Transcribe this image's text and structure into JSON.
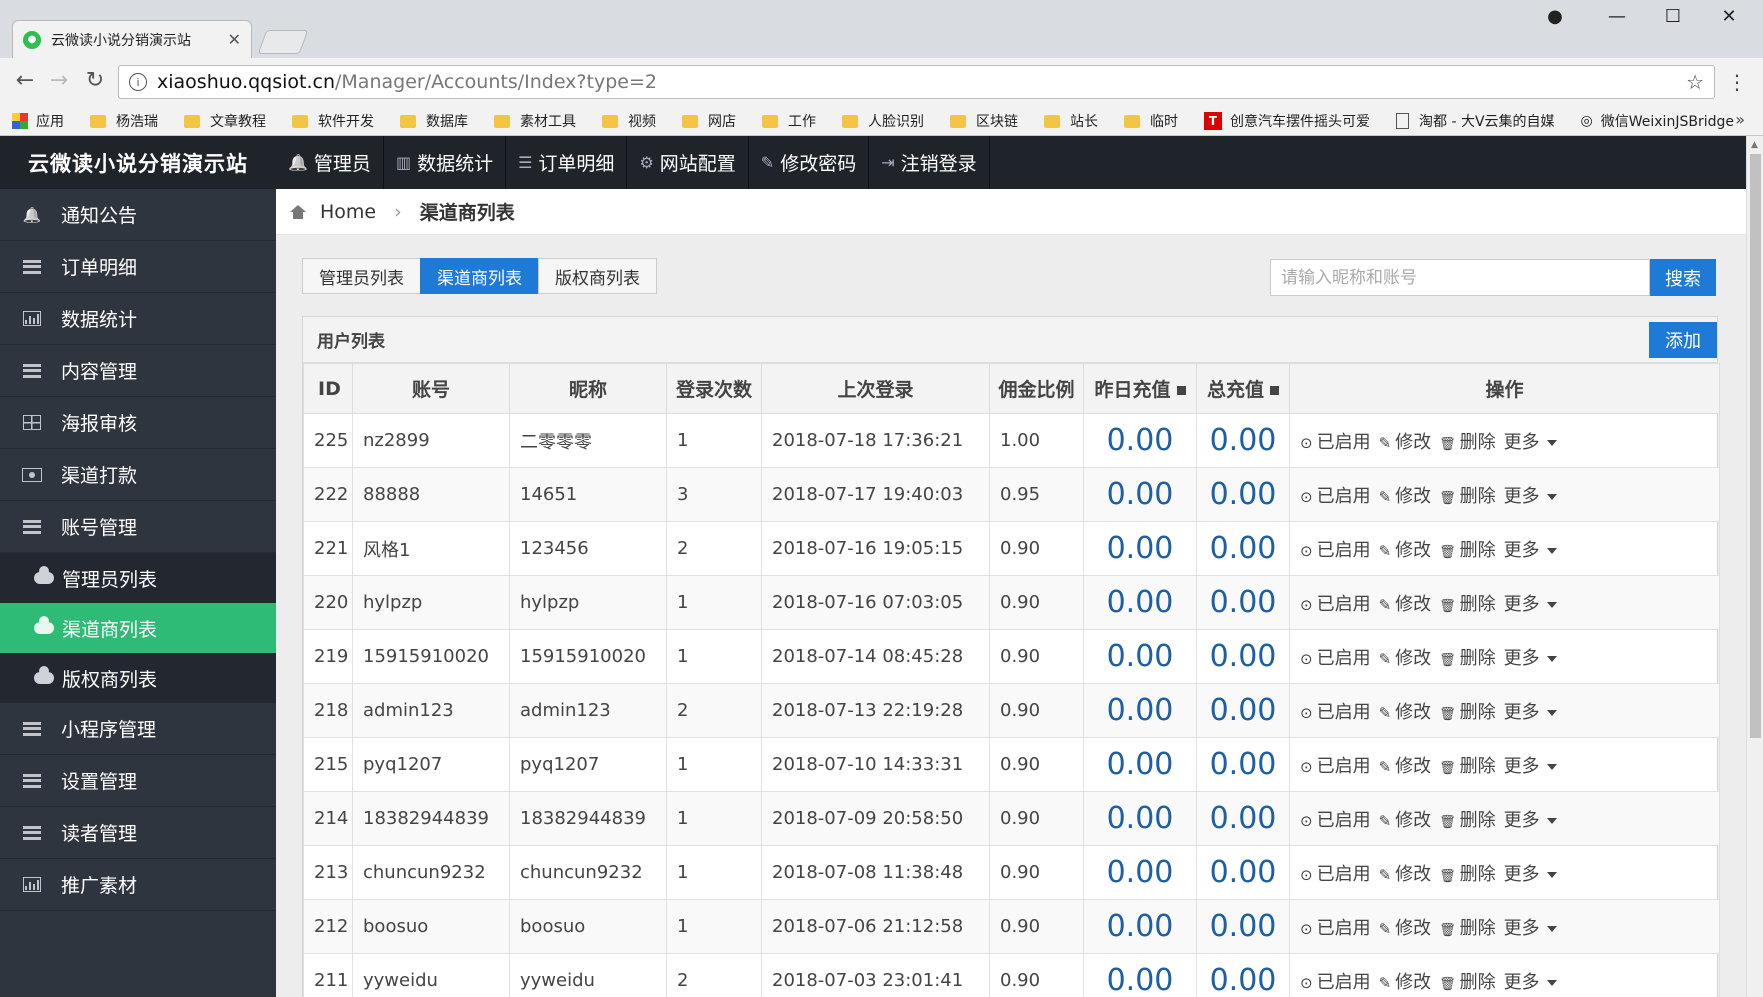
{
  "browser": {
    "tab_title": "云微读小说分销演示站",
    "url_host": "xiaoshuo.qqsiot.cn",
    "url_path": "/Manager/Accounts/Index?type=2",
    "bookmarks": [
      "应用",
      "杨浩瑞",
      "文章教程",
      "软件开发",
      "数据库",
      "素材工具",
      "视频",
      "网店",
      "工作",
      "人脸识别",
      "区块链",
      "站长",
      "临时",
      "创意汽车摆件摇头可爱",
      "淘都 - 大V云集的自媒",
      "微信WeixinJSBridge"
    ]
  },
  "brand": "云微读小说分销演示站",
  "topnav": [
    "管理员",
    "数据统计",
    "订单明细",
    "网站配置",
    "修改密码",
    "注销登录"
  ],
  "sidebar": {
    "items": [
      {
        "label": "通知公告",
        "icon": "bell-icon"
      },
      {
        "label": "订单明细",
        "icon": "list-icon"
      },
      {
        "label": "数据统计",
        "icon": "bar-chart-icon"
      },
      {
        "label": "内容管理",
        "icon": "list-icon"
      },
      {
        "label": "海报审核",
        "icon": "grid-icon"
      },
      {
        "label": "渠道打款",
        "icon": "money-icon"
      },
      {
        "label": "账号管理",
        "icon": "list-icon"
      }
    ],
    "sub_items": [
      "管理员列表",
      "渠道商列表",
      "版权商列表"
    ],
    "active_sub": "渠道商列表",
    "items_after": [
      {
        "label": "小程序管理",
        "icon": "list-icon"
      },
      {
        "label": "设置管理",
        "icon": "list-icon"
      },
      {
        "label": "读者管理",
        "icon": "list-icon"
      },
      {
        "label": "推广素材",
        "icon": "bar-chart-icon"
      }
    ]
  },
  "breadcrumb": {
    "home": "Home",
    "current": "渠道商列表"
  },
  "tabs": [
    "管理员列表",
    "渠道商列表",
    "版权商列表"
  ],
  "active_tab": "渠道商列表",
  "search": {
    "placeholder": "请输入昵称和账号",
    "button": "搜索"
  },
  "panel": {
    "title": "用户列表",
    "add_button": "添加"
  },
  "table": {
    "columns": [
      "ID",
      "账号",
      "昵称",
      "登录次数",
      "上次登录",
      "佣金比例",
      "昨日充值",
      "总充值",
      "操作"
    ],
    "actions": {
      "enabled": "已启用",
      "edit": "修改",
      "delete": "删除",
      "more": "更多"
    },
    "rows": [
      [
        "225",
        "nz2899",
        "二零零零",
        "1",
        "2018-07-18 17:36:21",
        "1.00",
        "0.00",
        "0.00"
      ],
      [
        "222",
        "88888",
        "14651",
        "3",
        "2018-07-17 19:40:03",
        "0.95",
        "0.00",
        "0.00"
      ],
      [
        "221",
        "风格1",
        "123456",
        "2",
        "2018-07-16 19:05:15",
        "0.90",
        "0.00",
        "0.00"
      ],
      [
        "220",
        "hylpzp",
        "hylpzp",
        "1",
        "2018-07-16 07:03:05",
        "0.90",
        "0.00",
        "0.00"
      ],
      [
        "219",
        "15915910020",
        "15915910020",
        "1",
        "2018-07-14 08:45:28",
        "0.90",
        "0.00",
        "0.00"
      ],
      [
        "218",
        "admin123",
        "admin123",
        "2",
        "2018-07-13 22:19:28",
        "0.90",
        "0.00",
        "0.00"
      ],
      [
        "215",
        "pyq1207",
        "pyq1207",
        "1",
        "2018-07-10 14:33:31",
        "0.90",
        "0.00",
        "0.00"
      ],
      [
        "214",
        "18382944839",
        "18382944839",
        "1",
        "2018-07-09 20:58:50",
        "0.90",
        "0.00",
        "0.00"
      ],
      [
        "213",
        "chuncun9232",
        "chuncun9232",
        "1",
        "2018-07-08 11:38:48",
        "0.90",
        "0.00",
        "0.00"
      ],
      [
        "212",
        "boosuo",
        "boosuo",
        "1",
        "2018-07-06 21:12:58",
        "0.90",
        "0.00",
        "0.00"
      ],
      [
        "211",
        "yyweidu",
        "yyweidu",
        "2",
        "2018-07-03 23:01:41",
        "0.90",
        "0.00",
        "0.00"
      ]
    ]
  },
  "colors": {
    "accent": "#1e7ad6",
    "active_green": "#2dbb76",
    "sidebar_bg": "#2f353f",
    "header_bg": "#1f232a",
    "money": "#1c5ea8"
  }
}
